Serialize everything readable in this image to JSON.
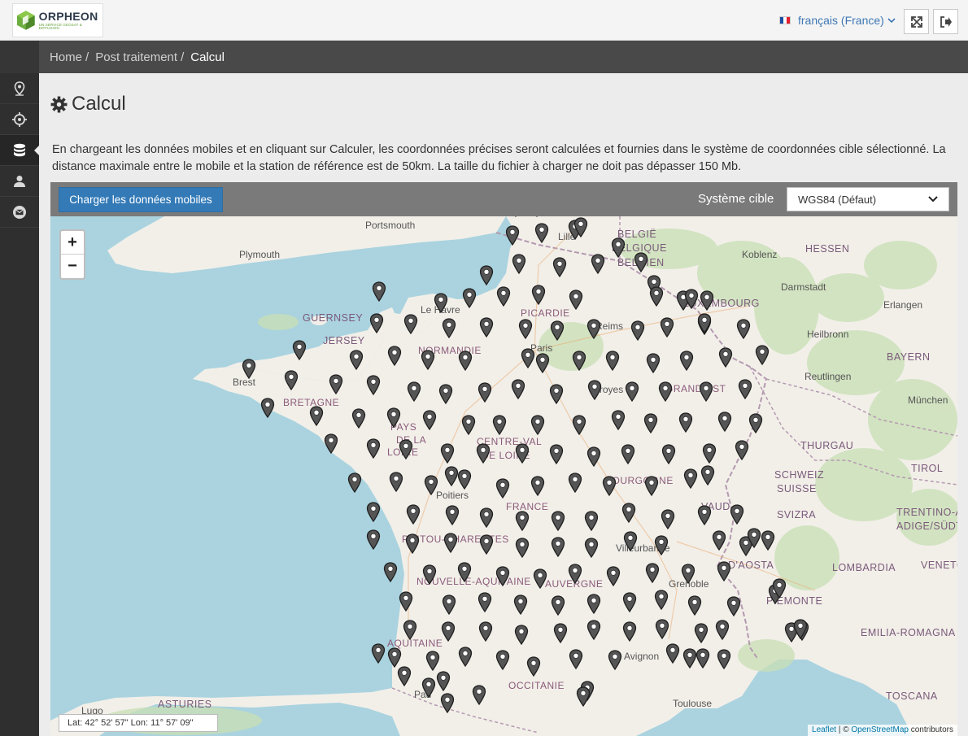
{
  "header": {
    "logo": {
      "name": "ORPHEON",
      "tagline": "UN SERVICE GEOSAT & DIFFUSION"
    },
    "language": {
      "label": "français (France)",
      "flag_colors": [
        "#1c4ea1",
        "#ffffff",
        "#e4202e"
      ]
    },
    "fullscreen_icon": "expand-icon",
    "logout_icon": "logout-icon"
  },
  "sidebar": {
    "items": [
      {
        "icon": "map-marker-icon"
      },
      {
        "icon": "crosshair-icon"
      },
      {
        "icon": "database-icon",
        "active": true
      },
      {
        "icon": "user-icon"
      },
      {
        "icon": "envelope-icon"
      }
    ]
  },
  "breadcrumb": {
    "items": [
      "Home",
      "Post traitement",
      "Calcul"
    ],
    "separator": "/"
  },
  "page": {
    "title": "Calcul",
    "description": "En chargeant les données mobiles et en cliquant sur Calculer, les coordonnées précises seront calculées et fournies dans le système de coordonnées cible sélectionné. La distance maximale entre le mobile et la station de référence est de 50km. La taille du fichier à charger ne doit pas dépasser 150 Mb."
  },
  "toolbar": {
    "load_button": "Charger les données mobiles",
    "system_label": "Système cible",
    "system_value": "WGS84 (Défaut)"
  },
  "map": {
    "zoom_in": "+",
    "zoom_out": "−",
    "coords_readout": "Lat: 42° 52' 57\" Lon: 11° 57' 09\"",
    "attribution": {
      "leaflet": "Leaflet",
      "sep": " | © ",
      "osm": "OpenStreetMap",
      "suffix": " contributors"
    },
    "colors": {
      "sea": "#aad3df",
      "land": "#f2efe9",
      "forest": "#c8dfb4",
      "pin": "#555555"
    },
    "labels": {
      "portsmouth": "Portsmouth",
      "plymouth": "Plymouth",
      "guernsey": "GUERNSEY",
      "jersey": "JERSEY",
      "le_havre": "Le Havre",
      "lille": "Lille",
      "belgique": "BELGIË",
      "belgique2": "BELGIQUE",
      "belgien": "BELGIEN",
      "koblenz": "Koblenz",
      "hessen": "HESSEN",
      "darmstadt": "Darmstadt",
      "erlangen": "Erlangen",
      "luxembourg": "LUXEMBOURG",
      "heilbronn": "Heilbronn",
      "bayern": "BAYERN",
      "reutlingen": "Reutlingen",
      "munchen": "München",
      "thurgau": "THURGAU",
      "tirol": "TIROL",
      "schweiz": "SCHWEIZ",
      "suisse": "SUISSE",
      "svizzera": "SVIZRA",
      "trentino": "TRENTINO-ALTO",
      "adige": "ADIGE/SÜDTIROL",
      "lombardia": "LOMBARDIA",
      "veneto": "VENETO",
      "piemonte": "PIEMONTE",
      "aosta": "D'AOSTA",
      "emilia": "EMILIA-ROMAGNA",
      "toscana": "TOSCANA",
      "vaud": "VAUD",
      "brest": "Brest",
      "bretagne": "BRETAGNE",
      "normandie": "NORMANDIE",
      "picardie": "PICARDIE",
      "reims": "Reims",
      "paris": "Paris",
      "troyes": "Troyes",
      "grand_est": "GRAND EST",
      "pays_loire1": "PAYS",
      "pays_loire2": "DE LA",
      "pays_loire3": "LOIRE",
      "centre": "CENTRE-VAL",
      "centre2": "DE LOIRE",
      "france": "FRANCE",
      "bourgogne": "BOURGOGNE",
      "poitiers": "Poitiers",
      "poitou": "POITOU-CHARENTES",
      "nouvelle": "NOUVELLE-AQUITAINE",
      "auvergne": "AUVERGNE",
      "villeurbanne": "Villeurbanne",
      "grenoble": "Grenoble",
      "aquitaine": "AQUITAINE",
      "avignon": "Avignon",
      "occitanie": "OCCITANIE",
      "pau": "Pau",
      "toulouse": "Toulouse",
      "asturies": "ASTURIES",
      "lugo": "Lugo"
    }
  }
}
